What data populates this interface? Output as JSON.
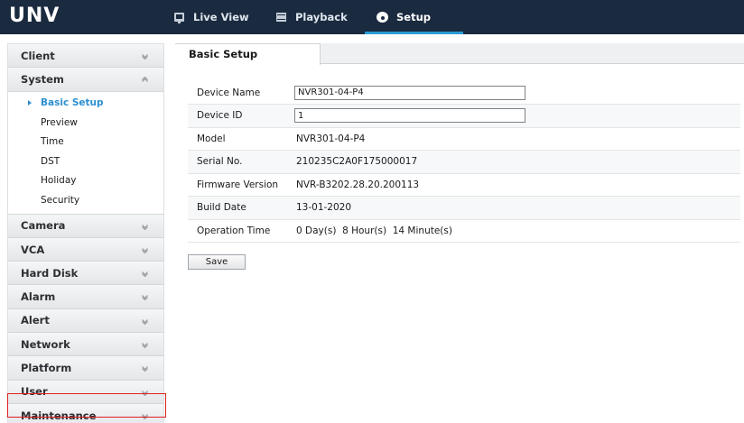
{
  "brand": {
    "logo": "UNV"
  },
  "topnav": {
    "items": [
      {
        "label": "Live View",
        "icon": "monitor-icon"
      },
      {
        "label": "Playback",
        "icon": "film-icon"
      },
      {
        "label": "Setup",
        "icon": "gear-icon",
        "active": true
      }
    ]
  },
  "sidebar": {
    "menus": [
      {
        "label": "Client",
        "expanded": false
      },
      {
        "label": "System",
        "expanded": true,
        "items": [
          "Basic Setup",
          "Preview",
          "Time",
          "DST",
          "Holiday",
          "Security"
        ],
        "active_item": "Basic Setup"
      },
      {
        "label": "Camera",
        "expanded": false
      },
      {
        "label": "VCA",
        "expanded": false
      },
      {
        "label": "Hard Disk",
        "expanded": false
      },
      {
        "label": "Alarm",
        "expanded": false
      },
      {
        "label": "Alert",
        "expanded": false
      },
      {
        "label": "Network",
        "expanded": false
      },
      {
        "label": "Platform",
        "expanded": false
      },
      {
        "label": "User",
        "expanded": false
      },
      {
        "label": "Maintenance",
        "expanded": false,
        "highlighted": true
      }
    ]
  },
  "main": {
    "tab": "Basic Setup",
    "fields": [
      {
        "label": "Device Name",
        "value": "NVR301-04-P4",
        "editable": true
      },
      {
        "label": "Device ID",
        "value": "1",
        "editable": true
      },
      {
        "label": "Model",
        "value": "NVR301-04-P4"
      },
      {
        "label": "Serial No.",
        "value": "210235C2A0F175000017"
      },
      {
        "label": "Firmware Version",
        "value": "NVR-B3202.28.20.200113"
      },
      {
        "label": "Build Date",
        "value": "13-01-2020"
      },
      {
        "label": "Operation Time",
        "value": "0 Day(s)  8 Hour(s)  14 Minute(s)"
      }
    ],
    "save_label": "Save"
  },
  "colors": {
    "topbar": "#1a2a3f",
    "accent": "#2a9bd5",
    "active_link": "#2d8fd0",
    "highlight_red": "#e02020"
  }
}
